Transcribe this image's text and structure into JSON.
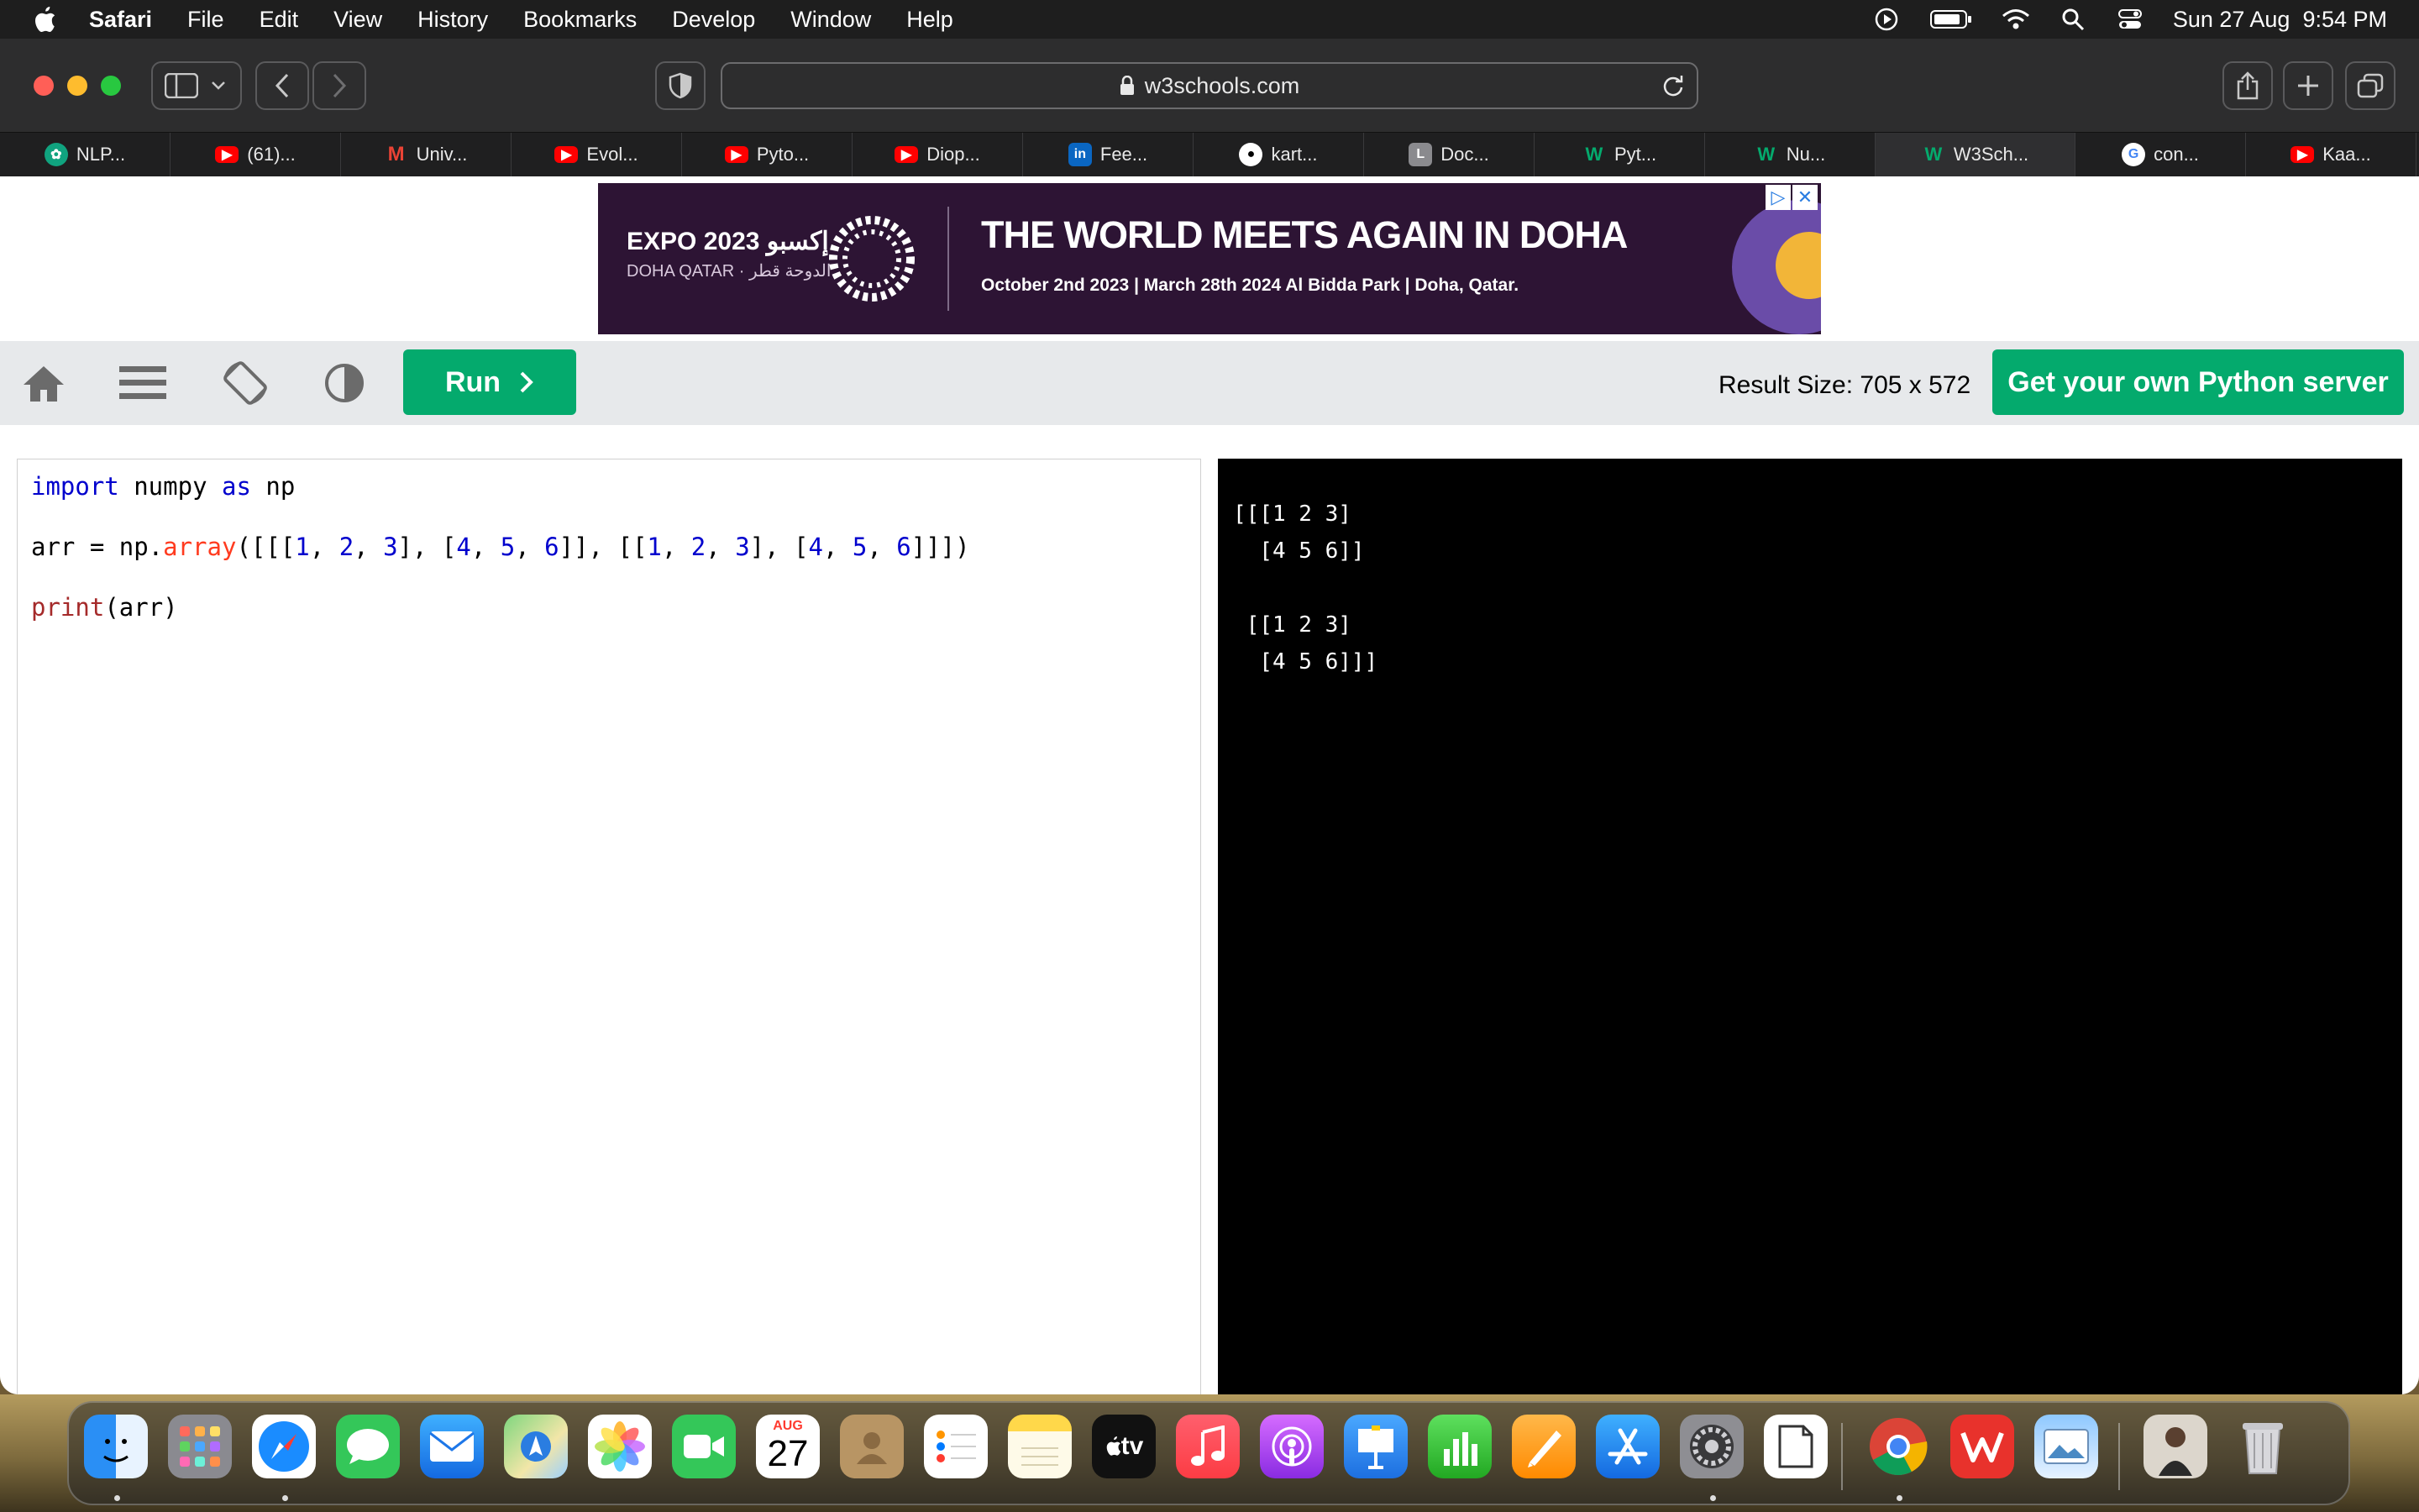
{
  "menubar": {
    "app_name": "Safari",
    "items": [
      "File",
      "Edit",
      "View",
      "History",
      "Bookmarks",
      "Develop",
      "Window",
      "Help"
    ],
    "clock": "Sun 27 Aug  9:54 PM"
  },
  "browser": {
    "url": "w3schools.com",
    "tabs": [
      {
        "label": "NLP...",
        "icon": "openai-icon"
      },
      {
        "label": "(61)...",
        "icon": "youtube-icon"
      },
      {
        "label": "Univ...",
        "icon": "gmail-icon"
      },
      {
        "label": "Evol...",
        "icon": "youtube-icon"
      },
      {
        "label": "Pyto...",
        "icon": "youtube-icon"
      },
      {
        "label": "Diop...",
        "icon": "youtube-icon"
      },
      {
        "label": "Fee...",
        "icon": "linkedin-icon"
      },
      {
        "label": "kart...",
        "icon": "github-icon"
      },
      {
        "label": "Doc...",
        "icon": "letter-l-icon"
      },
      {
        "label": "Pyt...",
        "icon": "w3schools-icon"
      },
      {
        "label": "Nu...",
        "icon": "w3schools-icon"
      },
      {
        "label": "W3Sch...",
        "icon": "w3schools-icon",
        "active": true
      },
      {
        "label": "con...",
        "icon": "google-icon"
      },
      {
        "label": "Kaa...",
        "icon": "youtube-icon"
      }
    ]
  },
  "ad": {
    "expo": "EXPO 2023 إكسبو",
    "location": "DOHA QATAR · الدوحة قطر",
    "headline": "THE WORLD MEETS AGAIN IN DOHA",
    "dates": "October 2nd 2023 | March 28th 2024 Al Bidda Park | Doha, Qatar."
  },
  "controls": {
    "run_label": "Run",
    "result_size": "Result Size: 705 x 572",
    "server_button": "Get your own Python server"
  },
  "editor": {
    "lines": [
      [
        {
          "t": "import",
          "c": "kw"
        },
        {
          "t": " numpy ",
          "c": ""
        },
        {
          "t": "as",
          "c": "kw"
        },
        {
          "t": " np",
          "c": ""
        }
      ],
      [
        {
          "t": "arr = np.",
          "c": ""
        },
        {
          "t": "array",
          "c": "attr"
        },
        {
          "t": "([[[",
          "c": ""
        },
        {
          "t": "1",
          "c": "num"
        },
        {
          "t": ", ",
          "c": ""
        },
        {
          "t": "2",
          "c": "num"
        },
        {
          "t": ", ",
          "c": ""
        },
        {
          "t": "3",
          "c": "num"
        },
        {
          "t": "], [",
          "c": ""
        },
        {
          "t": "4",
          "c": "num"
        },
        {
          "t": ", ",
          "c": ""
        },
        {
          "t": "5",
          "c": "num"
        },
        {
          "t": ", ",
          "c": ""
        },
        {
          "t": "6",
          "c": "num"
        },
        {
          "t": "]], [[",
          "c": ""
        },
        {
          "t": "1",
          "c": "num"
        },
        {
          "t": ", ",
          "c": ""
        },
        {
          "t": "2",
          "c": "num"
        },
        {
          "t": ", ",
          "c": ""
        },
        {
          "t": "3",
          "c": "num"
        },
        {
          "t": "], [",
          "c": ""
        },
        {
          "t": "4",
          "c": "num"
        },
        {
          "t": ", ",
          "c": ""
        },
        {
          "t": "5",
          "c": "num"
        },
        {
          "t": ", ",
          "c": ""
        },
        {
          "t": "6",
          "c": "num"
        },
        {
          "t": "]]])",
          "c": ""
        }
      ],
      [
        {
          "t": "print",
          "c": "fn"
        },
        {
          "t": "(arr)",
          "c": ""
        }
      ]
    ]
  },
  "output": {
    "lines": [
      "[[[1 2 3]",
      "  [4 5 6]]",
      "",
      " [[1 2 3]",
      "  [4 5 6]]]"
    ]
  },
  "dock": {
    "calendar_month": "AUG",
    "calendar_day": "27",
    "tv_label": "tv",
    "apps": [
      "finder-icon",
      "launchpad-icon",
      "safari-icon",
      "messages-icon",
      "mail-icon",
      "maps-icon",
      "photos-icon",
      "facetime-icon",
      "calendar-icon",
      "contacts-icon",
      "reminders-icon",
      "notes-icon",
      "apple-tv-icon",
      "music-icon",
      "podcasts-icon",
      "keynote-icon",
      "numbers-icon",
      "pages-icon",
      "app-store-icon",
      "system-settings-icon",
      "textedit-icon",
      "chrome-icon",
      "wps-icon",
      "preview-icon",
      "user-photo-icon",
      "trash-icon"
    ]
  }
}
